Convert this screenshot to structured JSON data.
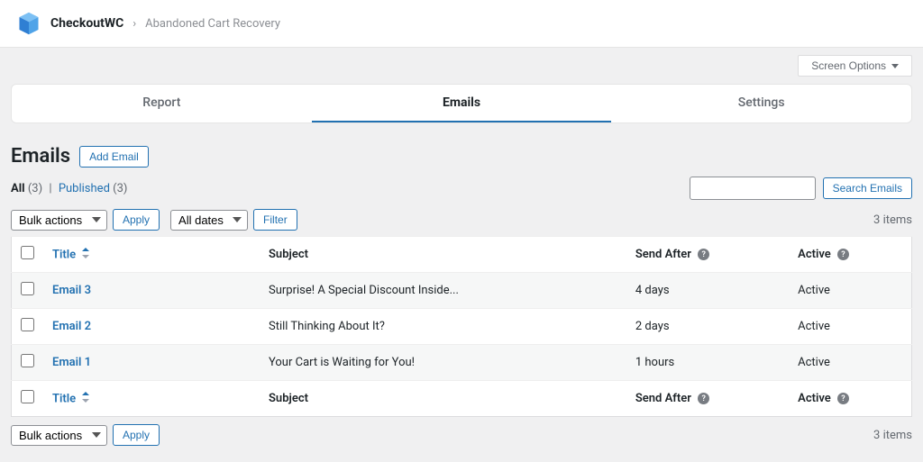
{
  "header": {
    "brand": "CheckoutWC",
    "crumb": "Abandoned Cart Recovery",
    "screen_options": "Screen Options"
  },
  "tabs": [
    {
      "label": "Report",
      "active": false
    },
    {
      "label": "Emails",
      "active": true
    },
    {
      "label": "Settings",
      "active": false
    }
  ],
  "page": {
    "title": "Emails",
    "add_button": "Add Email"
  },
  "statuses": {
    "all_label": "All",
    "all_count": "(3)",
    "published_label": "Published",
    "published_count": "(3)",
    "separator": "|"
  },
  "search": {
    "placeholder": "",
    "button": "Search Emails"
  },
  "top_actions": {
    "bulk_select": "Bulk actions",
    "apply": "Apply",
    "dates_select": "All dates",
    "filter": "Filter",
    "items_count": "3 items"
  },
  "columns": {
    "title": "Title",
    "subject": "Subject",
    "send_after": "Send After",
    "active": "Active"
  },
  "rows": [
    {
      "title": "Email 3",
      "subject": "Surprise! A Special Discount Inside...",
      "send_after": "4 days",
      "active": "Active"
    },
    {
      "title": "Email 2",
      "subject": "Still Thinking About It?",
      "send_after": "2 days",
      "active": "Active"
    },
    {
      "title": "Email 1",
      "subject": "Your Cart is Waiting for You!",
      "send_after": "1 hours",
      "active": "Active"
    }
  ],
  "bottom_actions": {
    "bulk_select": "Bulk actions",
    "apply": "Apply",
    "items_count": "3 items"
  }
}
